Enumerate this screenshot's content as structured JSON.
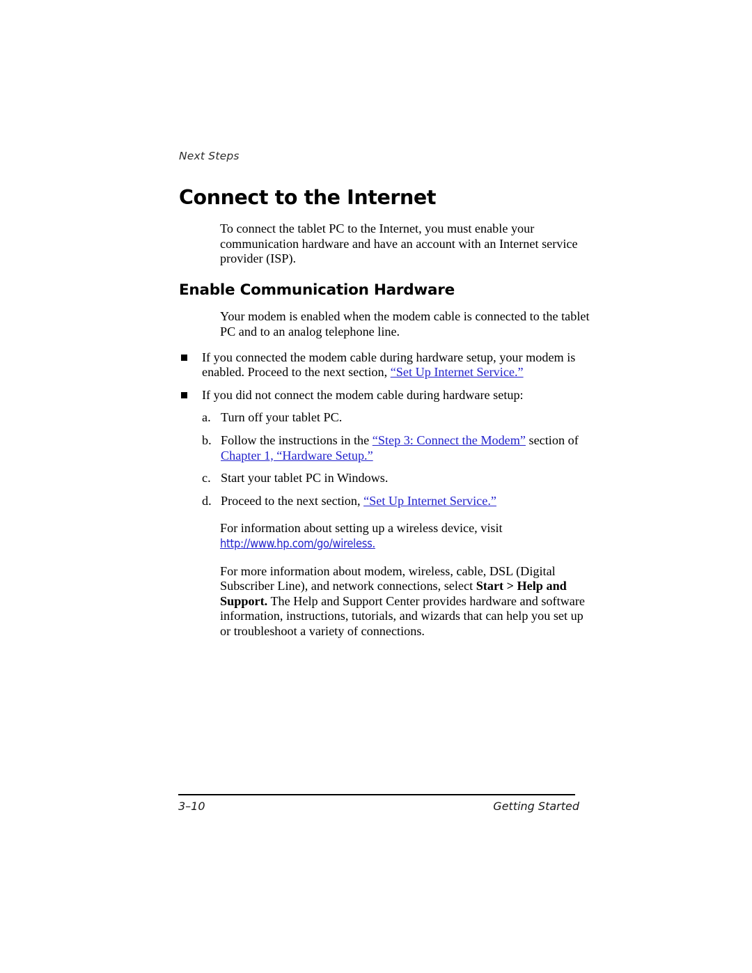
{
  "colors": {
    "link": "#2222cc",
    "text": "#000000",
    "header_text": "#2b2b2b"
  },
  "running_header": "Next Steps",
  "chapter_title": "Connect to the Internet",
  "intro_paragraph": "To connect the tablet PC to the Internet, you must enable your communication hardware and have an account with an Internet service provider (ISP).",
  "section_title": "Enable Communication Hardware",
  "section_intro": "Your modem is enabled when the modem cable is connected to the tablet PC and to an analog telephone line.",
  "bullets": [
    {
      "text_before": "If you connected the modem cable during hardware setup, your modem is enabled. Proceed to the next section, ",
      "link": "“Set Up Internet Service.”",
      "text_after": ""
    },
    {
      "text_before": "If you did not connect the modem cable during hardware setup:",
      "link": "",
      "text_after": ""
    }
  ],
  "steps": [
    {
      "marker": "a.",
      "segments": [
        {
          "type": "plain",
          "text": "Turn off your tablet PC."
        }
      ]
    },
    {
      "marker": "b.",
      "segments": [
        {
          "type": "plain",
          "text": "Follow the instructions in the "
        },
        {
          "type": "link",
          "text": "“Step 3: Connect the Modem”"
        },
        {
          "type": "plain",
          "text": " section of "
        },
        {
          "type": "link",
          "text": "Chapter 1, “Hardware Setup.”"
        }
      ]
    },
    {
      "marker": "c.",
      "segments": [
        {
          "type": "plain",
          "text": "Start your tablet PC in Windows."
        }
      ]
    },
    {
      "marker": "d.",
      "segments": [
        {
          "type": "plain",
          "text": "Proceed to the next section, "
        },
        {
          "type": "link",
          "text": "“Set Up Internet Service.”"
        }
      ]
    }
  ],
  "wireless_paragraph": {
    "text_before": "For information about setting up a wireless device, visit ",
    "url": "http://www.hp.com/go/wireless.",
    "text_after": ""
  },
  "more_info_paragraph": {
    "part1": "For more information about modem, wireless, cable, DSL (Digital Subscriber Line), and network connections, select ",
    "bold": "Start > Help and Support.",
    "part2": " The Help and Support Center provides hardware and software information, instructions, tutorials, and wizards that can help you set up or troubleshoot a variety of connections."
  },
  "footer": {
    "page_number": "3–10",
    "guide_name": "Getting Started"
  }
}
